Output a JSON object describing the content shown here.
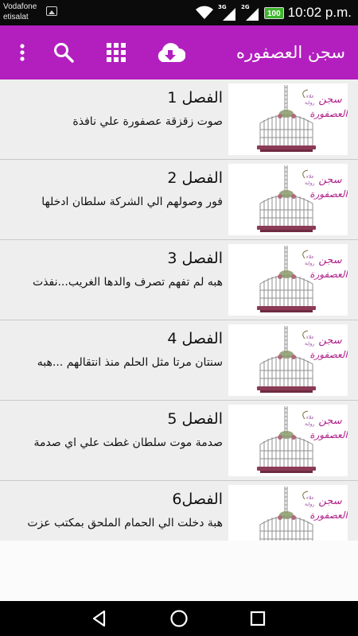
{
  "status_bar": {
    "carrier_line1": "Vodafone",
    "carrier_line2": "etisalat",
    "network1": "3G",
    "network2": "2G",
    "battery": "100",
    "time": "10:02 p.m.",
    "icons": [
      "image-notification-icon",
      "wifi-icon",
      "signal-3g-icon",
      "signal-2g-icon",
      "battery-icon"
    ]
  },
  "app_bar": {
    "title": "سجن العصفوره",
    "color": "#b31fbf",
    "actions": [
      "download-icon",
      "grid-icon",
      "search-icon",
      "overflow-menu-icon"
    ]
  },
  "chapters": [
    {
      "title": "الفصل 1",
      "subtitle": "صوت زقزقة عصفورة علي نافذة"
    },
    {
      "title": "الفصل 2",
      "subtitle": "فور وصولهم الي الشركة سلطان ادخلها"
    },
    {
      "title": "الفصل 3",
      "subtitle": "هبه لم تفهم تصرف والدها الغريب...نفذت"
    },
    {
      "title": "الفصل 4",
      "subtitle": "سنتان مرتا مثل الحلم منذ انتقالهم ...هبه"
    },
    {
      "title": "الفصل 5",
      "subtitle": "صدمة موت سلطان غطت علي اي صدمة"
    },
    {
      "title": "الفصل6",
      "subtitle": "هبة دخلت الي الحمام الملحق بمكتب عزت"
    }
  ],
  "thumbnail": {
    "logo_line1": "سجن",
    "logo_line2": "العصفورة"
  },
  "nav_bar": {
    "icons": [
      "back-icon",
      "home-icon",
      "recents-icon"
    ]
  }
}
